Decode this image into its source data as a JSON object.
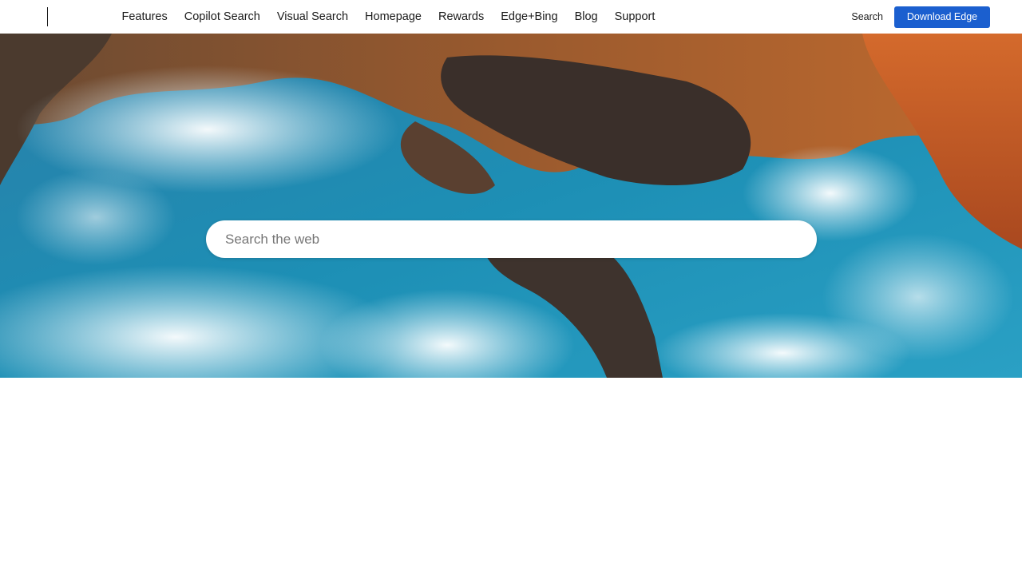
{
  "nav": {
    "items": [
      {
        "label": "Features"
      },
      {
        "label": "Copilot Search"
      },
      {
        "label": "Visual Search"
      },
      {
        "label": "Homepage"
      },
      {
        "label": "Rewards"
      },
      {
        "label": "Edge+Bing"
      },
      {
        "label": "Blog"
      },
      {
        "label": "Support"
      }
    ],
    "search_label": "Search",
    "download_label": "Download Edge"
  },
  "hero": {
    "image": "aerial-coastline-photo",
    "search_placeholder": "Search the web"
  },
  "colors": {
    "accent": "#1b5fcf",
    "text": "#1b1b1b"
  }
}
